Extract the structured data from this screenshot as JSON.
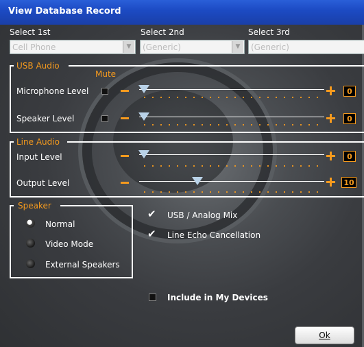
{
  "window": {
    "title": "View Database Record"
  },
  "selectors": [
    {
      "label": "Select 1st",
      "value": "Cell Phone"
    },
    {
      "label": "Select 2nd",
      "value": "(Generic)"
    },
    {
      "label": "Select 3rd",
      "value": "(Generic)"
    }
  ],
  "usb_audio": {
    "legend": "USB Audio",
    "mute_label": "Mute",
    "rows": [
      {
        "label": "Microphone Level",
        "value": "0",
        "level": 0
      },
      {
        "label": "Speaker Level",
        "value": "0",
        "level": 0
      }
    ]
  },
  "line_audio": {
    "legend": "Line Audio",
    "rows": [
      {
        "label": "Input Level",
        "value": "0",
        "level": 0
      },
      {
        "label": "Output Level",
        "value": "10",
        "level": 0.33
      }
    ]
  },
  "speaker": {
    "legend": "Speaker",
    "options": [
      {
        "label": "Normal",
        "selected": true
      },
      {
        "label": "Video Mode",
        "selected": false
      },
      {
        "label": "External Speakers",
        "selected": false
      }
    ]
  },
  "options": {
    "usb_analog_mix": "USB / Analog Mix",
    "line_echo_cancellation": "Line Echo Cancellation",
    "include_in_my_devices": "Include in My Devices"
  },
  "ok_button": "Ok",
  "colors": {
    "accent": "#f59a1e",
    "titlebar": "#1c4bc4"
  }
}
